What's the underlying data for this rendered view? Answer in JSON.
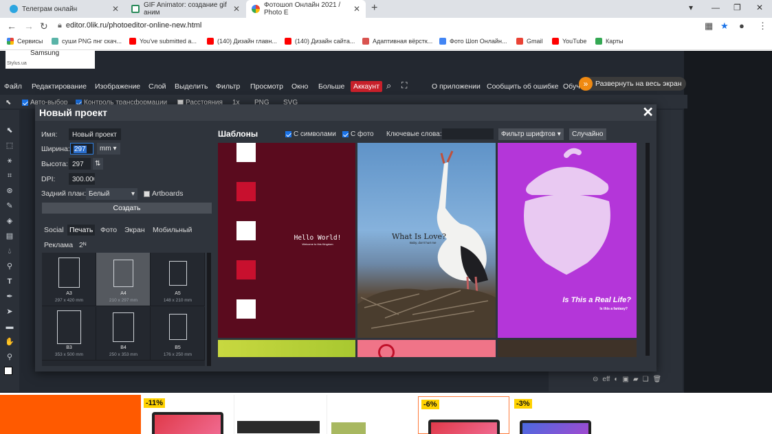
{
  "browser": {
    "tabs": [
      {
        "title": "Телеграм онлайн",
        "icon": "telegram-icon"
      },
      {
        "title": "GIF Animator: создание gif аним",
        "icon": "gif-animator-icon"
      },
      {
        "title": "Фотошоп Онлайн 2021 / Photo E",
        "icon": "photoshop-online-icon"
      }
    ],
    "url": "editor.0lik.ru/photoeditor-online-new.html",
    "bookmarks": [
      {
        "label": "Сервисы",
        "icon": "apps-icon",
        "color": "#e94235"
      },
      {
        "label": "суши PNG пнг скач...",
        "icon": "png-site-icon",
        "color": "#5ab4a8"
      },
      {
        "label": "You've submitted a...",
        "icon": "youtube-icon",
        "color": "#ff0000"
      },
      {
        "label": "(140) Дизайн главн...",
        "icon": "youtube-icon",
        "color": "#ff0000"
      },
      {
        "label": "(140) Дизайн сайта...",
        "icon": "youtube-icon",
        "color": "#ff0000"
      },
      {
        "label": "Адаптивная вёрстк...",
        "icon": "bookmark-h-icon",
        "color": "#d9534f"
      },
      {
        "label": "Фото Шоп Онлайн...",
        "icon": "photoshop-icon",
        "color": "#4285f4"
      },
      {
        "label": "Gmail",
        "icon": "gmail-icon",
        "color": "#ea4335"
      },
      {
        "label": "YouTube",
        "icon": "youtube-icon",
        "color": "#ff0000"
      },
      {
        "label": "Карты",
        "icon": "maps-icon",
        "color": "#34a853"
      }
    ]
  },
  "ad_top": {
    "brand": "Samsung",
    "site": "Stylus.ua"
  },
  "menu": {
    "items": [
      "Файл",
      "Редактирование",
      "Изображение",
      "Слой",
      "Выделить",
      "Фильтр",
      "Просмотр",
      "Окно",
      "Больше"
    ],
    "account": "Аккаунт",
    "about": "О приложении",
    "report": "Сообщить об ошибке",
    "learn": "Обуч",
    "expand": "Развернуть на весь экран"
  },
  "options_bar": {
    "auto_select": "Авто-выбор",
    "transform": "Контроль трансформации",
    "distances": "Расстояния",
    "zoom": "1x",
    "png": "PNG",
    "svg": "SVG"
  },
  "dialog": {
    "title": "Новый проект",
    "name_label": "Имя:",
    "name_value": "Новый проект",
    "width_label": "Ширина:",
    "width_value": "297",
    "unit": "mm",
    "height_label": "Высота:",
    "height_value": "297",
    "dpi_label": "DPI:",
    "dpi_value": "300.000",
    "bg_label": "Задний план:",
    "bg_value": "Белый",
    "artboards": "Artboards",
    "create": "Создать",
    "categories": [
      "Social",
      "Печать",
      "Фото",
      "Экран",
      "Мобильный",
      "Реклама",
      "2ᴺ"
    ],
    "active_category": "Печать",
    "papers": [
      {
        "name": "A3",
        "size": "297 x 420 mm"
      },
      {
        "name": "A4",
        "size": "210 x 297 mm"
      },
      {
        "name": "A5",
        "size": "148 x 210 mm"
      },
      {
        "name": "B3",
        "size": "353 x 500 mm"
      },
      {
        "name": "B4",
        "size": "250 x 353 mm"
      },
      {
        "name": "B5",
        "size": "176 x 250 mm"
      }
    ],
    "templates_title": "Шаблоны",
    "with_symbols": "С символами",
    "with_photo": "С фото",
    "keywords_label": "Ключевые слова:",
    "font_filter": "Фильтр шрифтов",
    "random": "Случайно",
    "templates": [
      {
        "title": "Hello World!",
        "subtitle": "Welcome to this Kingdom"
      },
      {
        "title": "What Is Love?",
        "subtitle": "Baby, don't hurt me"
      },
      {
        "title": "Is This a Real Life?",
        "subtitle": "Is this a fantasy?"
      }
    ]
  },
  "bottom_ads": [
    {
      "badge": "-11%"
    },
    {
      "badge": "-6%"
    },
    {
      "badge": "-3%"
    }
  ]
}
